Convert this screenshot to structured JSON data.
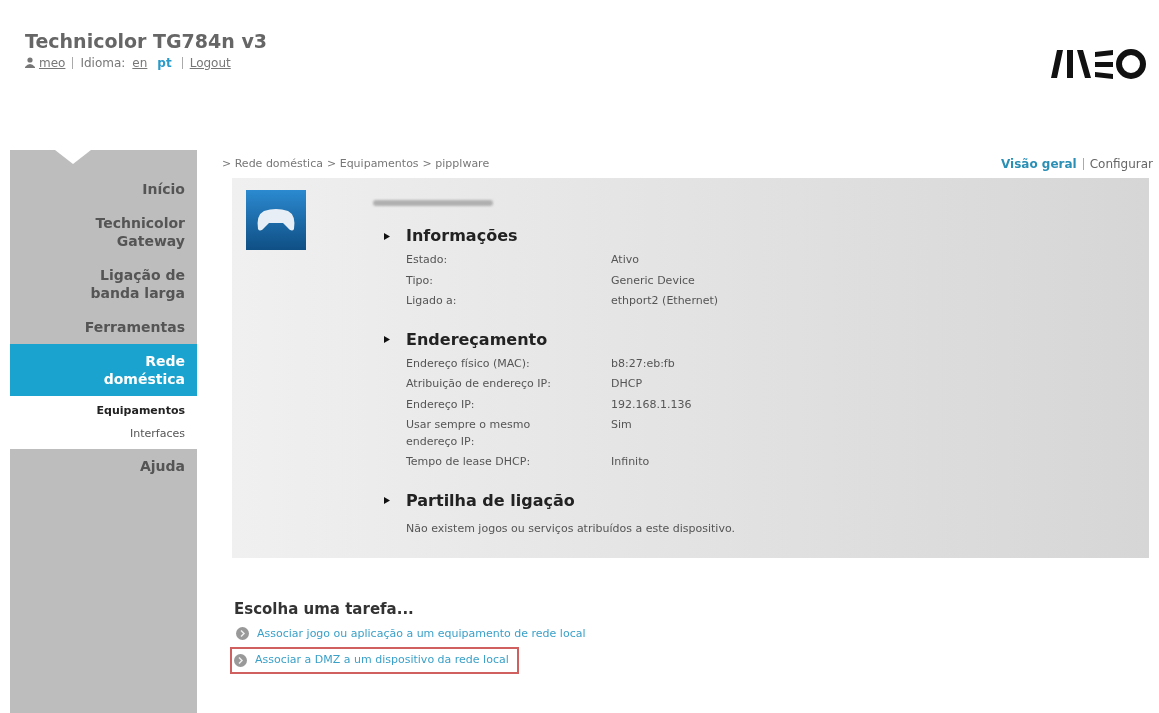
{
  "header": {
    "title": "Technicolor TG784n v3",
    "user": "meo",
    "language_label": "Idioma:",
    "languages": [
      {
        "label": "en",
        "selected": false
      },
      {
        "label": "pt",
        "selected": true
      }
    ],
    "logout": "Logout"
  },
  "sidebar": {
    "items": [
      {
        "label": "Início",
        "selected": false
      },
      {
        "label": "Technicolor Gateway",
        "selected": false
      },
      {
        "label": "Ligação de banda larga",
        "selected": false
      },
      {
        "label": "Ferramentas",
        "selected": false
      },
      {
        "label": "Rede doméstica",
        "selected": true,
        "children": [
          {
            "label": "Equipamentos",
            "selected": true
          },
          {
            "label": "Interfaces",
            "selected": false
          }
        ]
      },
      {
        "label": "Ajuda",
        "selected": false
      }
    ]
  },
  "breadcrumb": [
    "> Rede doméstica",
    "> Equipamentos",
    "> pipplware"
  ],
  "view_links": [
    {
      "label": "Visão geral",
      "selected": true
    },
    {
      "label": "Configurar",
      "selected": false
    }
  ],
  "sections": [
    {
      "title": "Informações",
      "rows": [
        {
          "label": "Estado:",
          "value": "Ativo"
        },
        {
          "label": "Tipo:",
          "value": "Generic Device"
        },
        {
          "label": "Ligado a:",
          "value": "ethport2 (Ethernet)"
        }
      ]
    },
    {
      "title": "Endereçamento",
      "rows": [
        {
          "label": "Endereço físico (MAC):",
          "value": "b8:27:eb:fb"
        },
        {
          "label": "Atribuição de endereço IP:",
          "value": "DHCP"
        },
        {
          "label": "Endereço IP:",
          "value": "192.168.1.136"
        },
        {
          "label": "Usar sempre o mesmo endereço IP:",
          "value": "Sim"
        },
        {
          "label": "Tempo de lease DHCP:",
          "value": "Infinito"
        }
      ]
    },
    {
      "title": "Partilha de ligação",
      "note": "Não existem jogos ou serviços atribuídos a este dispositivo."
    }
  ],
  "tasks": {
    "title": "Escolha uma tarefa...",
    "items": [
      {
        "label": "Associar jogo ou aplicação a um equipamento de rede local",
        "highlighted": false
      },
      {
        "label": "Associar a DMZ a um dispositivo da rede local",
        "highlighted": true
      }
    ]
  }
}
